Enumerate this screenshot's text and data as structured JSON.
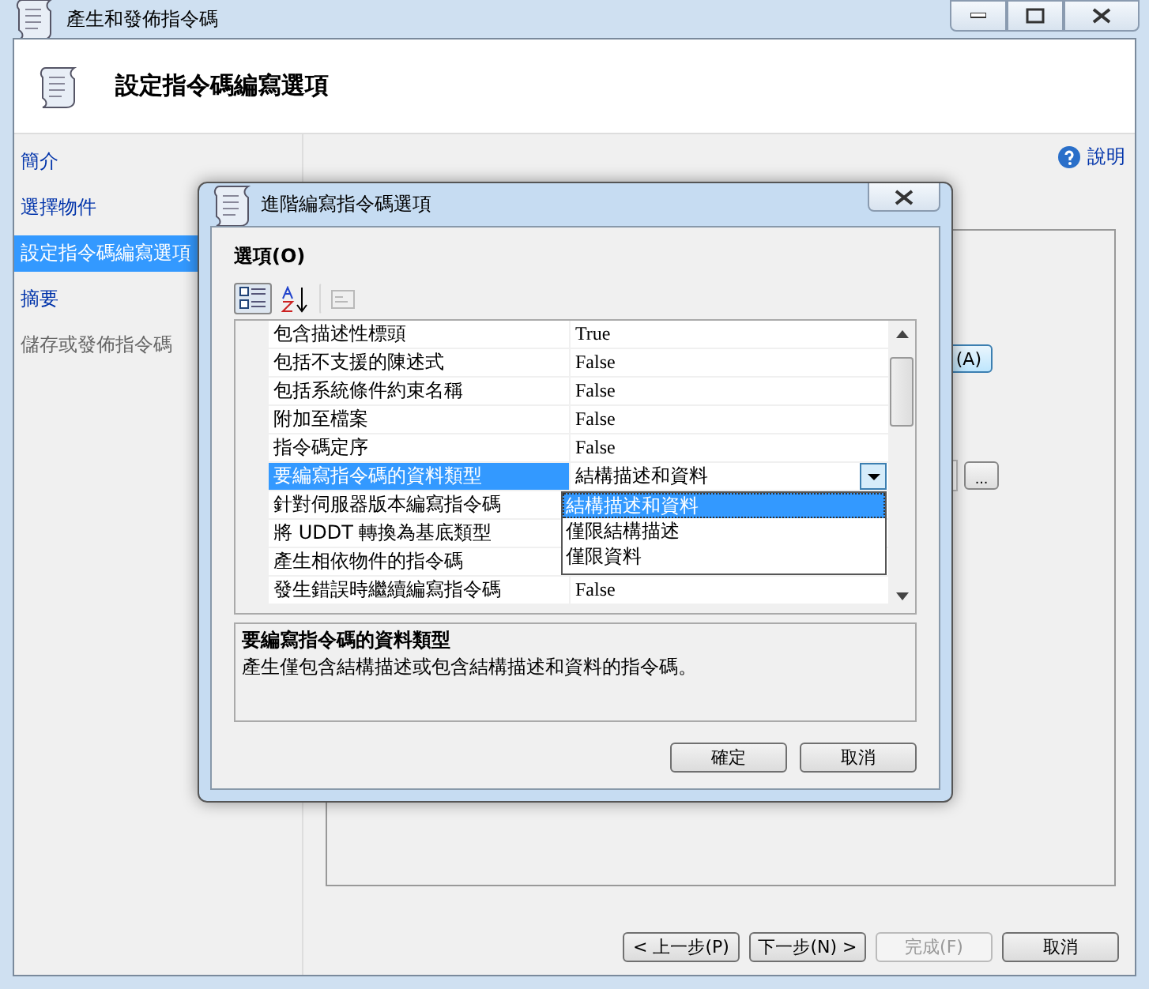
{
  "window": {
    "title": "產生和發佈指令碼"
  },
  "header": {
    "title": "設定指令碼編寫選項"
  },
  "nav": [
    {
      "label": "簡介",
      "selected": false,
      "disabled": false
    },
    {
      "label": "選擇物件",
      "selected": false,
      "disabled": false
    },
    {
      "label": "設定指令碼編寫選項",
      "selected": true,
      "disabled": false
    },
    {
      "label": "摘要",
      "selected": false,
      "disabled": false
    },
    {
      "label": "儲存或發佈指令碼",
      "selected": false,
      "disabled": true
    }
  ],
  "help_link": "說明",
  "partial_button": "(A)",
  "browse_button": "...",
  "buttons": [
    {
      "label": "< 上一步(P)",
      "disabled": false
    },
    {
      "label": "下一步(N) >",
      "disabled": false
    },
    {
      "label": "完成(F)",
      "disabled": true
    },
    {
      "label": "取消",
      "disabled": false
    }
  ],
  "dialog": {
    "title": "進階編寫指令碼選項",
    "options_label": "選項(O)",
    "toolbar": [
      {
        "kind": "categorized",
        "selected": true,
        "disabled": false
      },
      {
        "kind": "alphabetical",
        "selected": false,
        "disabled": false
      },
      {
        "kind": "property_pages",
        "selected": false,
        "disabled": true
      }
    ],
    "rows": [
      {
        "name": "包含描述性標頭",
        "value": "True",
        "selected": false
      },
      {
        "name": "包括不支援的陳述式",
        "value": "False",
        "selected": false
      },
      {
        "name": "包括系統條件約束名稱",
        "value": "False",
        "selected": false
      },
      {
        "name": "附加至檔案",
        "value": "False",
        "selected": false
      },
      {
        "name": "指令碼定序",
        "value": "False",
        "selected": false
      },
      {
        "name": "要編寫指令碼的資料類型",
        "value": "結構描述和資料",
        "selected": true
      },
      {
        "name": "針對伺服器版本編寫指令碼",
        "selected": false
      },
      {
        "name": "將 UDDT 轉換為基底類型",
        "selected": false
      },
      {
        "name": "產生相依物件的指令碼",
        "selected": false
      },
      {
        "name": "發生錯誤時繼續編寫指令碼",
        "value": "False",
        "selected": false
      }
    ],
    "dropdown": [
      {
        "label": "結構描述和資料",
        "selected": true
      },
      {
        "label": "僅限結構描述",
        "selected": false
      },
      {
        "label": "僅限資料",
        "selected": false
      }
    ],
    "description": {
      "title": "要編寫指令碼的資料類型",
      "text": "產生僅包含結構描述或包含結構描述和資料的指令碼。"
    },
    "buttons": [
      "確定",
      "取消"
    ]
  }
}
